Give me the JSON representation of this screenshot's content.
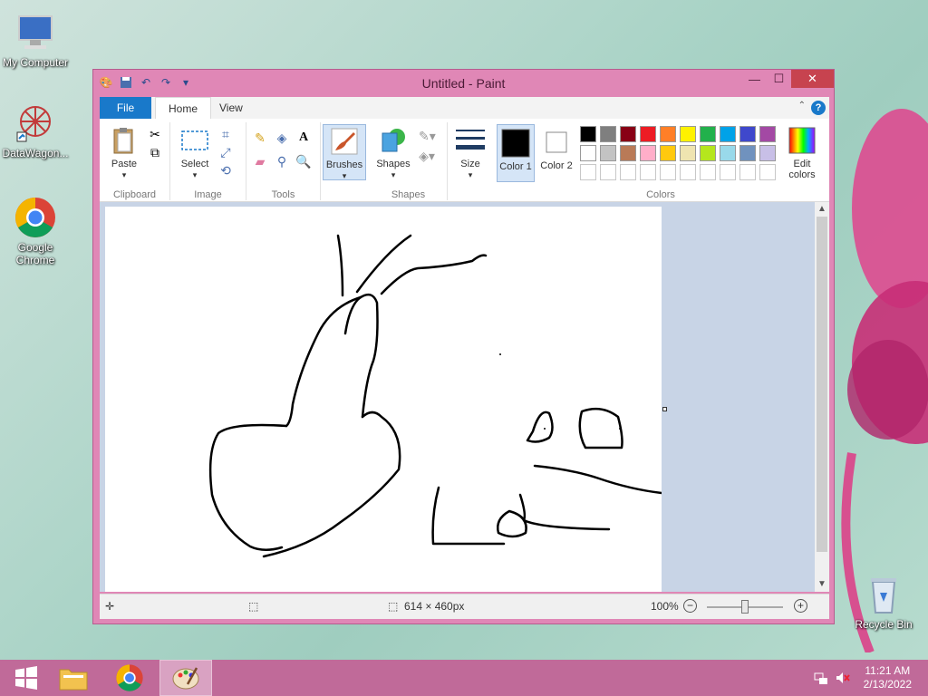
{
  "desktop": {
    "icons": [
      {
        "label": "My Computer"
      },
      {
        "label": "DataWagon..."
      },
      {
        "label": "Google Chrome"
      },
      {
        "label": "Recycle Bin"
      }
    ]
  },
  "window": {
    "title": "Untitled - Paint",
    "tabs": {
      "file": "File",
      "home": "Home",
      "view": "View"
    },
    "help": "?",
    "groups": {
      "clipboard": {
        "label": "Clipboard",
        "paste": "Paste"
      },
      "image": {
        "label": "Image",
        "select": "Select"
      },
      "tools": {
        "label": "Tools"
      },
      "brushes": {
        "label": "Brushes"
      },
      "shapes": {
        "label": "Shapes",
        "shapes_btn": "Shapes"
      },
      "size": {
        "label": "Size"
      },
      "colors": {
        "label": "Colors",
        "color1": "Color 1",
        "color2": "Color 2",
        "edit": "Edit colors"
      }
    },
    "palette_row1": [
      "#000000",
      "#7f7f7f",
      "#880015",
      "#ed1c24",
      "#ff7f27",
      "#fff200",
      "#22b14c",
      "#00a2e8",
      "#3f48cc",
      "#a349a4"
    ],
    "palette_row2": [
      "#ffffff",
      "#c3c3c3",
      "#b97a57",
      "#ffaec9",
      "#ffc90e",
      "#efe4b0",
      "#b5e61d",
      "#99d9ea",
      "#7092be",
      "#c8bfe7"
    ],
    "status": {
      "dimensions": "614 × 460px",
      "zoom": "100%",
      "zoom_fraction": 0.5
    }
  },
  "taskbar": {
    "time": "11:21 AM",
    "date": "2/13/2022"
  }
}
